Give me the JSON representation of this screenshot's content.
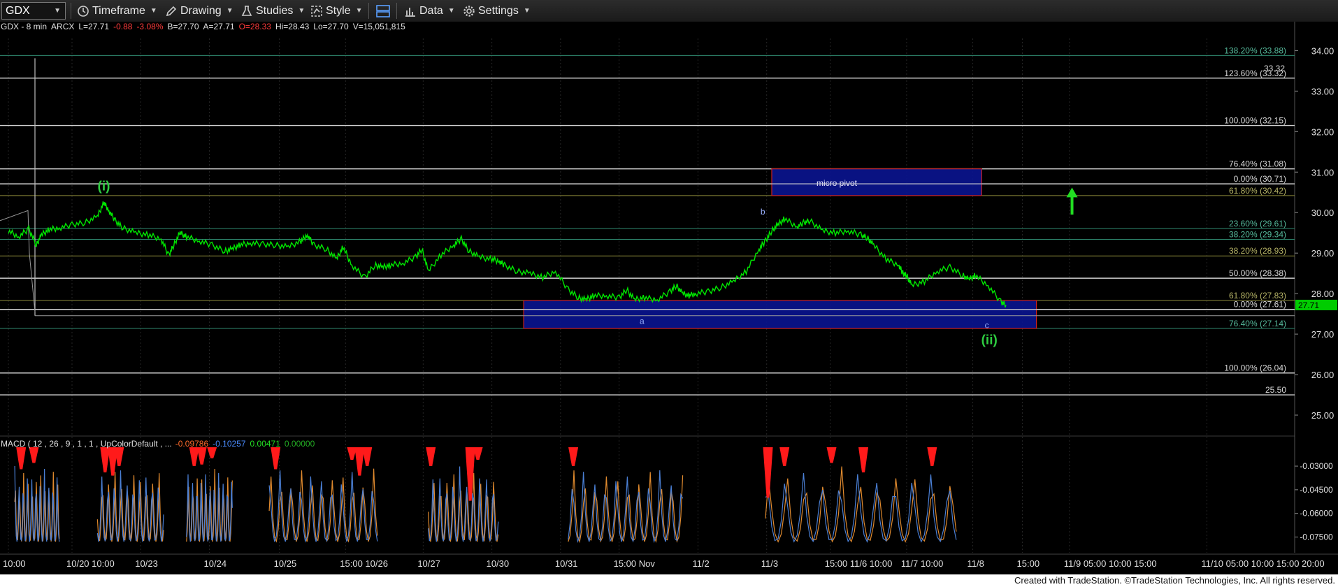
{
  "toolbar": {
    "symbol": "GDX",
    "timeframe": "Timeframe",
    "drawing": "Drawing",
    "studies": "Studies",
    "style": "Style",
    "data": "Data",
    "settings": "Settings"
  },
  "info_bar": {
    "symbol_line": "GDX - 8 min  ARCX",
    "last": "L=27.71",
    "change": "-0.88",
    "change_pct": "-3.08%",
    "bid": "B=27.70",
    "ask": "A=27.71",
    "open": "O=28.33",
    "high": "Hi=28.43",
    "low": "Lo=27.70",
    "volume": "V=15,051,815"
  },
  "macd_legend": {
    "name": "MACD ( 12 , 26 , 9 , 1 , 1 , UpColorDefault , ...",
    "v1": "-0.09786",
    "v2": "-0.10257",
    "v3": "0.00471",
    "v4": "0.00000"
  },
  "footer": "Created with TradeStation. ©TradeStation Technologies, Inc. All rights reserved.",
  "colors": {
    "price": "#00e600",
    "macd_line": "#4a7fd4",
    "signal_line": "#e08a2e",
    "histogram": "#ff1a1a",
    "box_fill": "#0a1490",
    "box_border": "#cc2222",
    "fib_olive": "#8c8a3a",
    "fib_teal": "#2f8a70",
    "level_white": "#d0d0d0",
    "last_price_tag": "#00cc00"
  },
  "chart_data": {
    "type": "line",
    "title": "",
    "ylim": [
      24.5,
      34.3
    ],
    "y_ticks": [
      "34.00",
      "33.00",
      "32.00",
      "31.00",
      "30.00",
      "29.00",
      "28.00",
      "27.00",
      "26.00",
      "25.00"
    ],
    "macd_ylim": [
      -0.085,
      -0.018
    ],
    "macd_ticks": [
      "-0.03000",
      "-0.04500",
      "-0.06000",
      "-0.07500"
    ],
    "x_labels": [
      {
        "t": 0.0,
        "label": "10:00"
      },
      {
        "t": 5.0,
        "label": "10/20 10:00"
      },
      {
        "t": 10.4,
        "label": "10/23"
      },
      {
        "t": 15.8,
        "label": "10/24"
      },
      {
        "t": 21.3,
        "label": "10/25"
      },
      {
        "t": 26.5,
        "label": "15:00 10/26"
      },
      {
        "t": 32.6,
        "label": "10/27"
      },
      {
        "t": 38.0,
        "label": "10/30"
      },
      {
        "t": 43.4,
        "label": "10/31"
      },
      {
        "t": 48.0,
        "label": "15:00 Nov"
      },
      {
        "t": 54.2,
        "label": "11/2"
      },
      {
        "t": 59.6,
        "label": "11/3"
      },
      {
        "t": 64.6,
        "label": "15:00 11/6 10:00"
      },
      {
        "t": 70.6,
        "label": "11/7 10:00"
      },
      {
        "t": 75.8,
        "label": "11/8"
      },
      {
        "t": 79.7,
        "label": "15:00"
      },
      {
        "t": 83.4,
        "label": "11/9  05:00 10:00 15:00"
      },
      {
        "t": 94.2,
        "label": "11/10 05:00 10:00 15:00 20:00"
      }
    ],
    "series": [
      {
        "x": [
          0,
          0.8,
          1.6,
          2.2,
          2.6,
          3.2,
          4.0,
          5.0,
          6.0,
          7.0,
          7.5,
          7.9,
          8.4,
          9.0,
          10.0,
          11.0,
          12.0,
          12.6,
          13.0,
          13.5,
          14.0,
          15.0,
          16.0,
          17.0,
          17.6,
          18.2,
          19.0,
          20.0,
          21.0,
          22.0,
          23.0,
          23.5,
          24.0,
          25.0,
          25.8,
          26.3,
          27.0,
          28.0,
          28.8,
          29.4,
          30.0,
          31.0,
          32.0,
          32.5,
          33.0,
          34.0,
          35.0,
          35.6,
          36.2,
          37.0,
          38.0,
          38.6,
          39.0,
          40.0,
          41.0,
          42.0,
          43.0,
          44.0,
          44.8,
          45.4,
          46.0,
          47.0,
          48.0,
          48.6,
          49.2,
          50.0,
          51.0,
          52.0,
          52.5,
          53.0,
          53.5,
          54.0,
          55.0,
          56.0,
          57.0,
          58.0,
          59.0,
          59.5,
          60.0,
          60.5,
          61.0,
          62.0,
          62.5,
          63.0,
          64.0,
          65.0,
          66.0,
          67.0,
          67.5,
          68.0,
          69.0,
          70.0,
          70.3,
          70.6,
          71.0,
          72.0,
          73.0,
          74.0,
          75.0,
          75.5,
          76.0,
          77.0,
          78.0,
          78.4
        ],
        "y": [
          29.55,
          29.4,
          29.6,
          29.2,
          29.45,
          29.58,
          29.62,
          29.7,
          29.75,
          29.9,
          30.25,
          30.05,
          29.8,
          29.62,
          29.5,
          29.45,
          29.35,
          28.95,
          29.2,
          29.5,
          29.4,
          29.3,
          29.2,
          29.05,
          29.1,
          29.2,
          29.25,
          29.22,
          29.2,
          29.15,
          29.3,
          29.45,
          29.2,
          29.1,
          28.85,
          29.15,
          28.7,
          28.4,
          28.7,
          28.65,
          28.7,
          28.75,
          28.9,
          29.1,
          28.55,
          28.95,
          29.2,
          29.35,
          29.05,
          28.9,
          28.85,
          28.8,
          28.7,
          28.55,
          28.5,
          28.4,
          28.55,
          28.1,
          27.9,
          27.85,
          27.95,
          27.95,
          27.9,
          28.1,
          27.85,
          27.9,
          27.85,
          28.05,
          28.2,
          28.0,
          27.95,
          28.0,
          28.05,
          28.15,
          28.3,
          28.55,
          29.1,
          29.3,
          29.55,
          29.7,
          29.85,
          29.65,
          29.75,
          29.8,
          29.55,
          29.5,
          29.55,
          29.45,
          29.38,
          29.2,
          28.85,
          28.7,
          28.5,
          28.45,
          28.2,
          28.3,
          28.55,
          28.65,
          28.45,
          28.35,
          28.45,
          28.2,
          27.8,
          27.72
        ]
      }
    ],
    "fib_levels": [
      {
        "value": 33.88,
        "label": "138.20% (33.88)",
        "color": "teal"
      },
      {
        "value": 33.32,
        "label": "123.60% (33.32)",
        "color": "white"
      },
      {
        "value": 32.15,
        "label": "100.00% (32.15)",
        "color": "white"
      },
      {
        "value": 31.08,
        "label": "76.40% (31.08)",
        "color": "white"
      },
      {
        "value": 30.71,
        "label": "0.00% (30.71)",
        "color": "white"
      },
      {
        "value": 30.42,
        "label": "61.80% (30.42)",
        "color": "olive"
      },
      {
        "value": 29.61,
        "label": "23.60% (29.61)",
        "color": "teal"
      },
      {
        "value": 29.34,
        "label": "38.20% (29.34)",
        "color": "teal"
      },
      {
        "value": 28.93,
        "label": "38.20% (28.93)",
        "color": "olive"
      },
      {
        "value": 28.38,
        "label": "50.00% (28.38)",
        "color": "white"
      },
      {
        "value": 27.83,
        "label": "61.80% (27.83)",
        "color": "olive"
      },
      {
        "value": 27.61,
        "label": "0.00% (27.61)",
        "color": "white"
      },
      {
        "value": 27.14,
        "label": "76.40% (27.14)",
        "color": "teal"
      },
      {
        "value": 26.04,
        "label": "100.00% (26.04)",
        "color": "white"
      },
      {
        "value": 25.5,
        "label": "25.50",
        "color": "white"
      }
    ],
    "extra_price_label": "33.32",
    "last_price_tag": "27.71",
    "zones": [
      {
        "label": "micro pivot",
        "x0": 60.0,
        "x1": 76.5,
        "y0": 30.42,
        "y1": 31.08
      },
      {
        "label": "",
        "x0": 40.5,
        "x1": 80.8,
        "y0": 27.14,
        "y1": 27.83
      }
    ],
    "wave_labels": [
      {
        "text": "(i)",
        "x": 7.5,
        "y": 30.55,
        "color": "green"
      },
      {
        "text": "b",
        "x": 59.3,
        "y": 29.95,
        "color": "blue"
      },
      {
        "text": "a",
        "x": 49.8,
        "y": 27.25,
        "color": "blue"
      },
      {
        "text": "c",
        "x": 76.9,
        "y": 27.15,
        "color": "blue"
      },
      {
        "text": "(ii)",
        "x": 77.1,
        "y": 26.75,
        "color": "green"
      }
    ],
    "arrow": {
      "x": 83.6,
      "y0": 29.95,
      "y1": 30.55,
      "direction": "up"
    },
    "macd_segments": [
      {
        "x0": 0.5,
        "x1": 4.0,
        "bars": [
          [
            1.0,
            -0.032
          ],
          [
            2.0,
            -0.028
          ]
        ]
      },
      {
        "x0": 7.0,
        "x1": 12.2,
        "bars": [
          [
            7.6,
            -0.034
          ],
          [
            8.2,
            -0.036
          ],
          [
            8.7,
            -0.03
          ]
        ]
      },
      {
        "x0": 14.0,
        "x1": 17.6,
        "bars": [
          [
            14.6,
            -0.03
          ],
          [
            15.2,
            -0.029
          ],
          [
            16.0,
            -0.025
          ]
        ]
      },
      {
        "x0": 20.5,
        "x1": 29.0,
        "bars": [
          [
            21.0,
            -0.032
          ],
          [
            27.0,
            -0.026
          ],
          [
            27.6,
            -0.036
          ],
          [
            28.2,
            -0.03
          ]
        ]
      },
      {
        "x0": 33.0,
        "x1": 38.5,
        "bars": [
          [
            33.2,
            -0.03
          ],
          [
            36.3,
            -0.052
          ],
          [
            36.9,
            -0.026
          ]
        ]
      },
      {
        "x0": 44.0,
        "x1": 53.0,
        "bars": [
          [
            44.4,
            -0.03
          ]
        ]
      },
      {
        "x0": 59.5,
        "x1": 74.5,
        "bars": [
          [
            59.7,
            -0.05
          ],
          [
            61.0,
            -0.03
          ],
          [
            64.7,
            -0.028
          ],
          [
            67.2,
            -0.034
          ],
          [
            72.6,
            -0.03
          ]
        ]
      }
    ]
  }
}
